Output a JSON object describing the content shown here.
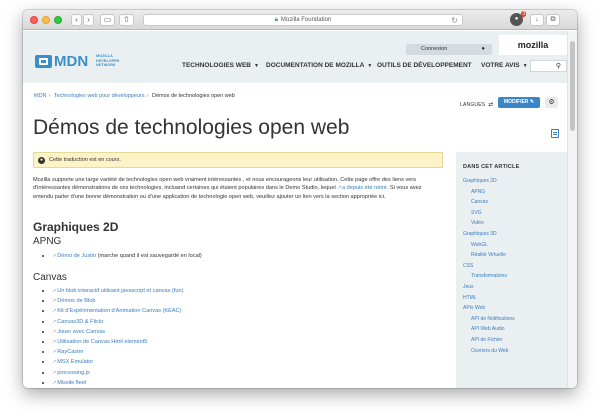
{
  "browser": {
    "address": "Mozilla Foundation",
    "ext_badge": "3"
  },
  "header": {
    "logo": "MDN",
    "logo_sub": "MOZILLA DEVELOPER NETWORK",
    "login": "Connexion",
    "mozilla": "mozilla",
    "nav": [
      "TECHNOLOGIES WEB",
      "DOCUMENTATION DE MOZILLA",
      "OUTILS DE DÉVELOPPEMENT",
      "VOTRE AVIS"
    ]
  },
  "breadcrumb": [
    "MDN",
    "Technologies web pour développeurs",
    "Démos de technologies open web"
  ],
  "actions": {
    "langues": "LANGUES",
    "modifier": "MODIFIER"
  },
  "page": {
    "title": "Démos de technologies open web",
    "notice": "Cette traduction est en cours.",
    "intro_1": "Mozilla supporte une large variété de technologies open web vraiment intéressantes , et nous encourageons leur utilisation. Cette page offre des",
    "intro_2": "liens vers d'intéressantes démonstrations de ces technologies, incluand certaines qui étaient populaires dans le Demo Studio,  lequel",
    "intro_link1": "a depuis",
    "intro_link2": "été retiré",
    "intro_3": ". Si vous avez entendu parler d'une bonne démonstration ou d'une application de technologie open web, veuillez ajouter un lien vers la",
    "intro_4": "section appropriée ici.",
    "section_graphics": "Graphiques 2D",
    "sub_apng": "APNG",
    "apng_items": [
      {
        "link": "Démo de Justin",
        "text": " (marche quand il est sauvegardé en local)"
      }
    ],
    "sub_canvas": "Canvas",
    "canvas_items": [
      "Un blob interactif utilisant javascript et canvas (fun)",
      "Démos de Blob",
      "Kit d'Expérimentation d'Animation Canvas (KEAC)",
      "Canvas3D & Flickr",
      "Jouer avec Canvas",
      "Utilisation de Canvas Html element5",
      "RayCaster",
      "MSX Emulator",
      "processing.js",
      "Missile fleet"
    ]
  },
  "toc": {
    "title": "DANS CET ARTICLE",
    "items": [
      {
        "label": "Graphiques 2D",
        "level": 1
      },
      {
        "label": "APNG",
        "level": 2
      },
      {
        "label": "Canvas",
        "level": 2
      },
      {
        "label": "SVG",
        "level": 2
      },
      {
        "label": "Vidéo",
        "level": 2
      },
      {
        "label": "Graphiques 3D",
        "level": 1
      },
      {
        "label": "WebGL",
        "level": 2
      },
      {
        "label": "Réalité Virtuelle",
        "level": 2
      },
      {
        "label": "CSS",
        "level": 1
      },
      {
        "label": "Transformations",
        "level": 2
      },
      {
        "label": "Jeux",
        "level": 1
      },
      {
        "label": "HTML",
        "level": 1
      },
      {
        "label": "APIs Web",
        "level": 1
      },
      {
        "label": "API de Notifications",
        "level": 2
      },
      {
        "label": "API Web Audio",
        "level": 2
      },
      {
        "label": "API de Fichier",
        "level": 2
      },
      {
        "label": "Ouvriers du Web",
        "level": 2
      }
    ]
  }
}
